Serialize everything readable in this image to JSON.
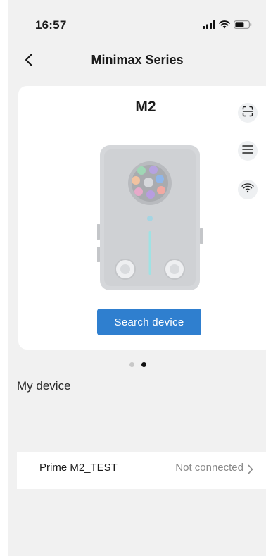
{
  "status_bar": {
    "time": "16:57"
  },
  "nav": {
    "title": "Minimax Series"
  },
  "device_card": {
    "model": "M2",
    "search_button_label": "Search device",
    "actions": [
      "scan-icon",
      "list-icon",
      "wifi-icon"
    ]
  },
  "pager": {
    "count": 2,
    "active_index": 1
  },
  "my_device": {
    "section_title": "My device",
    "items": [
      {
        "name": "Prime M2_TEST",
        "status": "Not connected"
      }
    ]
  },
  "colors": {
    "accent": "#2f7fcf",
    "background": "#f1f1f1",
    "card": "#ffffff",
    "muted_text": "#8a8a8a"
  }
}
